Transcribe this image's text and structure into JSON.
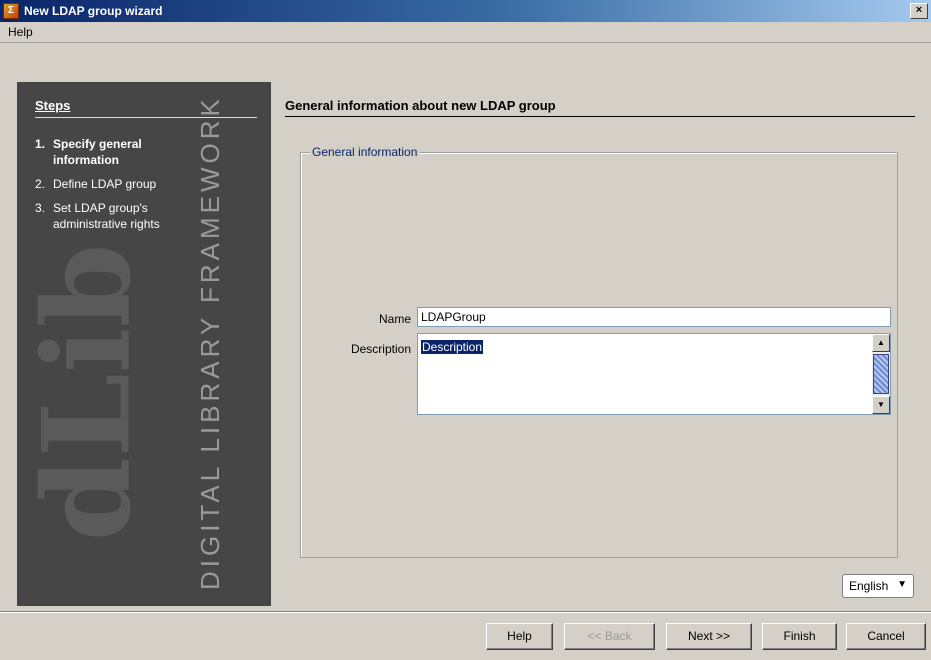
{
  "window": {
    "title": "New LDAP group wizard",
    "close_label": "×"
  },
  "menubar": {
    "items": [
      "Help"
    ]
  },
  "sidebar": {
    "steps_title": "Steps",
    "watermark_logo": "dLib",
    "watermark_text": "DIGITAL LIBRARY FRAMEWORK",
    "steps": [
      {
        "num": "1.",
        "label": "Specify general information",
        "current": true
      },
      {
        "num": "2.",
        "label": "Define LDAP group",
        "current": false
      },
      {
        "num": "3.",
        "label": "Set LDAP group's administrative rights",
        "current": false
      }
    ]
  },
  "main": {
    "title": "General information about new LDAP group",
    "group_title": "General information",
    "name_label": "Name",
    "name_value": "LDAPGroup",
    "description_label": "Description",
    "description_value": "Description"
  },
  "language": {
    "selected": "English"
  },
  "buttons": {
    "help": "Help",
    "back": "<< Back",
    "next": "Next >>",
    "finish": "Finish",
    "cancel": "Cancel"
  }
}
